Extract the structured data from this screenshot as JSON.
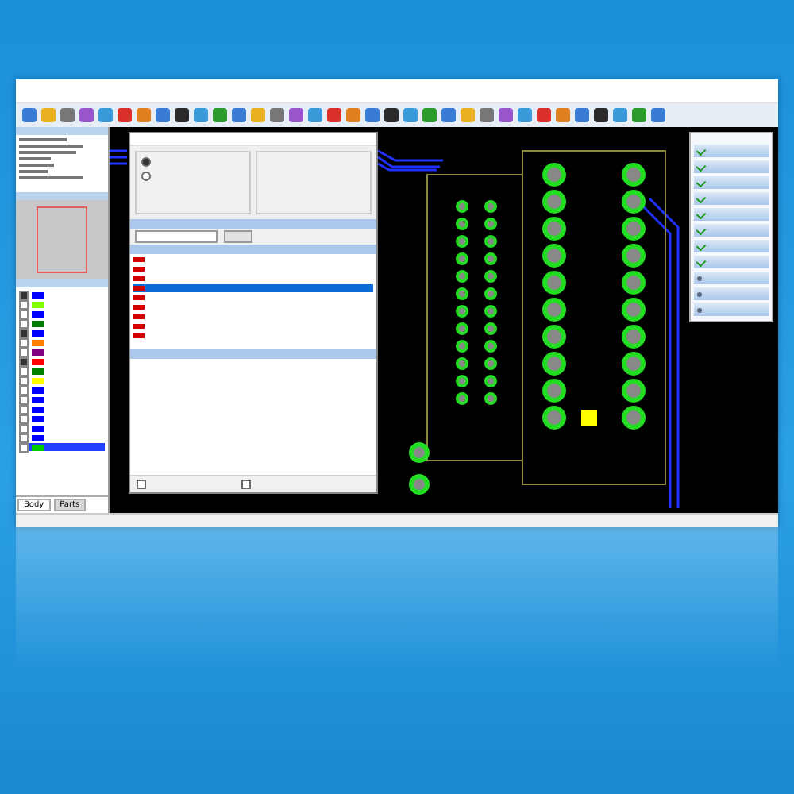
{
  "layers": [
    {
      "color": "#0000ff",
      "checked": true,
      "selected": false
    },
    {
      "color": "#80ff00",
      "checked": false,
      "selected": false
    },
    {
      "color": "#0000ff",
      "checked": false,
      "selected": false
    },
    {
      "color": "#008000",
      "checked": false,
      "selected": false
    },
    {
      "color": "#0000ff",
      "checked": true,
      "selected": false
    },
    {
      "color": "#ff8000",
      "checked": false,
      "selected": false
    },
    {
      "color": "#800080",
      "checked": false,
      "selected": false
    },
    {
      "color": "#ff0000",
      "checked": true,
      "selected": false
    },
    {
      "color": "#008000",
      "checked": false,
      "selected": false
    },
    {
      "color": "#ffff00",
      "checked": false,
      "selected": false
    },
    {
      "color": "#0000ff",
      "checked": false,
      "selected": false
    },
    {
      "color": "#0000ff",
      "checked": false,
      "selected": false
    },
    {
      "color": "#0000ff",
      "checked": false,
      "selected": false
    },
    {
      "color": "#0000ff",
      "checked": false,
      "selected": false
    },
    {
      "color": "#0000ff",
      "checked": false,
      "selected": false
    },
    {
      "color": "#0000ff",
      "checked": false,
      "selected": false
    },
    {
      "color": "#00cc00",
      "checked": false,
      "selected": true
    }
  ],
  "bottom_tabs": [
    {
      "label": "Body",
      "selected": true
    },
    {
      "label": "Parts",
      "selected": false
    }
  ],
  "net_rows": [
    {
      "selected": false
    },
    {
      "selected": false
    },
    {
      "selected": false
    },
    {
      "selected": true
    },
    {
      "selected": false
    },
    {
      "selected": false
    },
    {
      "selected": false
    },
    {
      "selected": false
    },
    {
      "selected": false
    }
  ],
  "radios": [
    {
      "selected": true
    },
    {
      "selected": false
    }
  ],
  "options": [
    {
      "checked": false
    },
    {
      "checked": false
    }
  ],
  "steps": [
    {
      "done": true
    },
    {
      "done": true
    },
    {
      "done": true
    },
    {
      "done": true
    },
    {
      "done": true
    },
    {
      "done": true
    },
    {
      "done": true
    },
    {
      "done": true
    },
    {
      "done": false
    },
    {
      "done": false
    },
    {
      "done": false
    }
  ]
}
